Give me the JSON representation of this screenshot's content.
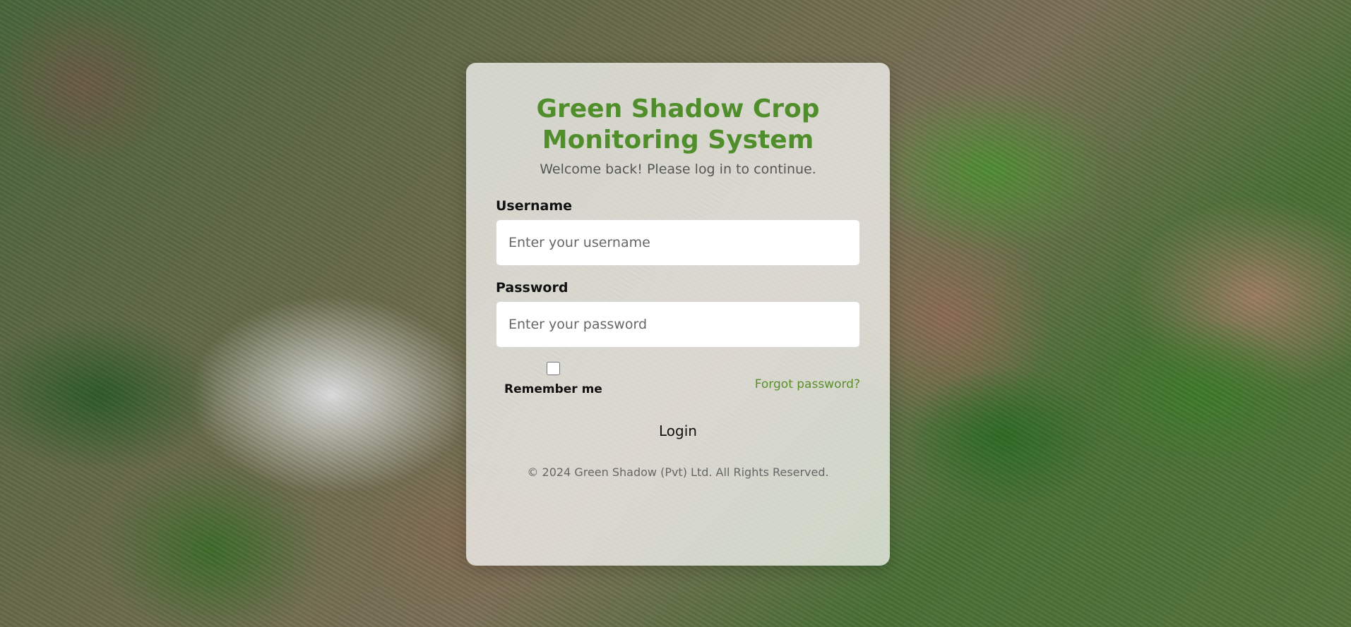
{
  "card": {
    "title": "Green Shadow Crop Monitoring System",
    "subtitle": "Welcome back! Please log in to continue."
  },
  "form": {
    "username_label": "Username",
    "username_placeholder": "Enter your username",
    "password_label": "Password",
    "password_placeholder": "Enter your password",
    "remember_label": "Remember me",
    "remember_checked": false,
    "forgot_label": "Forgot password?",
    "login_label": "Login"
  },
  "footer": {
    "copyright": "© 2024 Green Shadow (Pvt) Ltd. All Rights Reserved."
  },
  "colors": {
    "title": "#4f8e2a",
    "link": "#5b8f2a",
    "card_bg": "rgba(255,255,255,0.72)"
  }
}
